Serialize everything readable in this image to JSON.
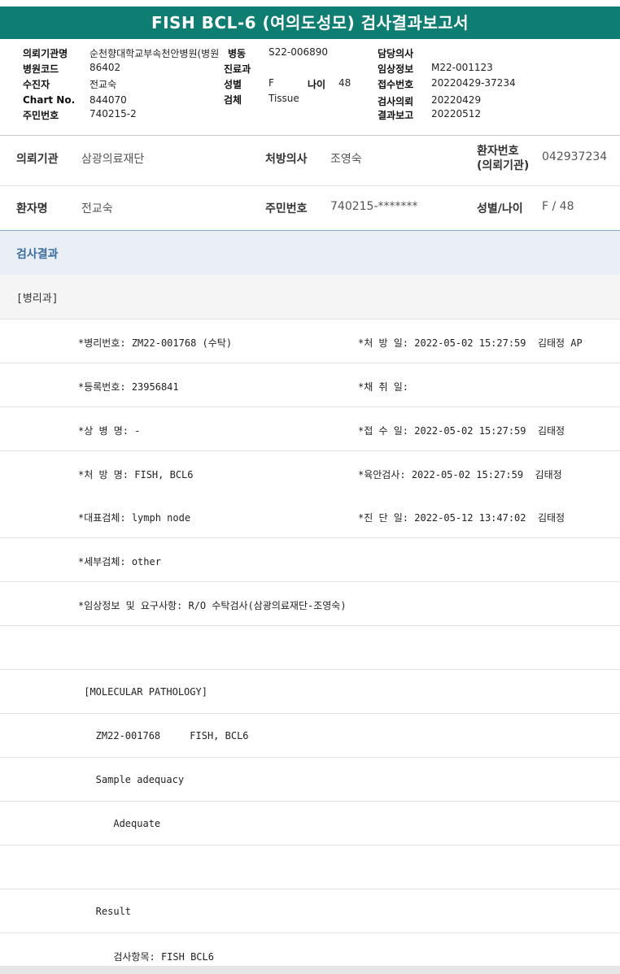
{
  "title": "FISH BCL-6 (여의도성모) 검사결과보고서",
  "header": {
    "inst_label": "의뢰기관명",
    "inst_value": "순천향대학교부속천안병원(병원",
    "ward_label": "병동",
    "ward_value": "S22-006890",
    "doctor_label": "담당의사",
    "doctor_value": "",
    "code_label": "병원코드",
    "code_value": "86402",
    "dept_label": "진료과",
    "dept_value": "",
    "clinical_label": "임상정보",
    "clinical_value": "M22-001123",
    "patient_label": "수진자",
    "patient_value": "전교숙",
    "sex_label": "성별",
    "sex_value": "F",
    "age_label": "나이",
    "age_value": "48",
    "receipt_label": "접수번호",
    "receipt_value": "20220429-37234",
    "chart_label": "Chart No.",
    "chart_value": "844070",
    "specimen_label": "검체",
    "specimen_value": "Tissue",
    "request_label": "검사의뢰",
    "request_value": "20220429",
    "rrn_label": "주민번호",
    "rrn_value": "740215-2",
    "report_label": "결과보고",
    "report_value": "20220512"
  },
  "info": {
    "req_inst_label": "의뢰기관",
    "req_inst_value": "삼광의료재단",
    "prescriber_label": "처방의사",
    "prescriber_value": "조영숙",
    "patient_no_label1": "환자번호",
    "patient_no_label2": "(의뢰기관)",
    "patient_no_value": "042937234",
    "patient_name_label": "환자명",
    "patient_name_value": "전교숙",
    "rrn_label": "주민번호",
    "rrn_value": "740215-*******",
    "sexage_label": "성별/나이",
    "sexage_value": "F / 48"
  },
  "section_title": "검사결과",
  "department": "[병리과]",
  "results": [
    {
      "left": "*병리번호: ZM22-001768 (수탁)",
      "right": "*처 방 일: 2022-05-02 15:27:59  김태정 AP"
    },
    {
      "left": "*등록번호: 23956841",
      "right": "*채 취 일:"
    },
    {
      "left": "*상 병 명: -",
      "right": "*접 수 일: 2022-05-02 15:27:59  김태정"
    },
    {
      "left": "*처 방 명: FISH, BCL6",
      "right": "*육안검사: 2022-05-02 15:27:59  김태정"
    },
    {
      "left": "*대표검체: lymph node",
      "right": "*진 단 일: 2022-05-12 13:47:02  김태정"
    },
    {
      "left": "*세부검체: other",
      "right": ""
    },
    {
      "left": "*임상정보 및 요구사항: R/O 수탁검사(삼광의료재단-조영숙)",
      "right": ""
    }
  ],
  "report_lines": [
    "",
    " [MOLECULAR PATHOLOGY]",
    "   ZM22-001768     FISH, BCL6",
    "   Sample adequacy",
    "      Adequate",
    "",
    "   Result",
    "      검사항목: FISH BCL6"
  ]
}
